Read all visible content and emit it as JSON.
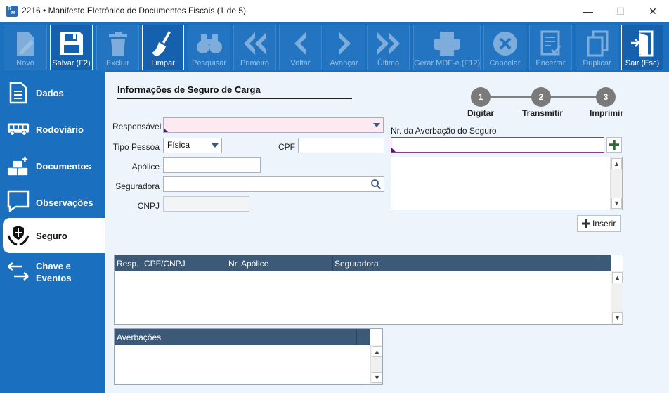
{
  "window": {
    "title": "2216 • Manifesto Eletrônico de Documentos Fiscais (1 de 5)",
    "app_icon_text": [
      "R",
      "M"
    ],
    "minimize": "—",
    "maximize": "☐",
    "close": "✕"
  },
  "toolbar": {
    "buttons": [
      {
        "label": "Novo",
        "icon": "edit-document-icon",
        "enabled": false
      },
      {
        "label": "Salvar (F2)",
        "icon": "save-disk-icon",
        "enabled": true
      },
      {
        "label": "Excluir",
        "icon": "trash-icon",
        "enabled": false
      },
      {
        "label": "Limpar",
        "icon": "broom-icon",
        "enabled": true
      },
      {
        "label": "Pesquisar",
        "icon": "binoculars-icon",
        "enabled": false
      },
      {
        "label": "Primeiro",
        "icon": "double-chevron-left-icon",
        "enabled": false
      },
      {
        "label": "Voltar",
        "icon": "chevron-left-icon",
        "enabled": false
      },
      {
        "label": "Avançar",
        "icon": "chevron-right-icon",
        "enabled": false
      },
      {
        "label": "Último",
        "icon": "double-chevron-right-icon",
        "enabled": false
      },
      {
        "label": "Gerar MDF-e (F12)",
        "icon": "printer-icon",
        "enabled": false
      },
      {
        "label": "Cancelar",
        "icon": "cancel-circle-icon",
        "enabled": false
      },
      {
        "label": "Encerrar",
        "icon": "checklist-icon",
        "enabled": false
      },
      {
        "label": "Duplicar",
        "icon": "copy-icon",
        "enabled": false
      },
      {
        "label": "Sair (Esc)",
        "icon": "exit-door-icon",
        "enabled": true
      }
    ]
  },
  "sidebar": {
    "items": [
      {
        "label": "Dados",
        "icon": "document-icon",
        "active": false
      },
      {
        "label": "Rodoviário",
        "icon": "bus-icon",
        "active": false
      },
      {
        "label": "Documentos",
        "icon": "documents-stack-icon",
        "active": false
      },
      {
        "label": "Observações",
        "icon": "speech-bubble-icon",
        "active": false
      },
      {
        "label": "Seguro",
        "icon": "shield-hands-icon",
        "active": true
      },
      {
        "label": "Chave e\nEventos",
        "icon": "arrows-exchange-icon",
        "active": false
      }
    ]
  },
  "main": {
    "section_title": "Informações de Seguro de Carga",
    "steps": [
      {
        "number": "1",
        "label": "Digitar"
      },
      {
        "number": "2",
        "label": "Transmitir"
      },
      {
        "number": "3",
        "label": "Imprimir"
      }
    ],
    "form": {
      "responsavel_label": "Responsável",
      "responsavel_value": "",
      "tipo_pessoa_label": "Tipo Pessoa",
      "tipo_pessoa_value": "Física",
      "cpf_label": "CPF",
      "cpf_value": "",
      "apolice_label": "Apólice",
      "apolice_value": "",
      "seguradora_label": "Seguradora",
      "seguradora_value": "",
      "cnpj_label": "CNPJ",
      "cnpj_value": "",
      "averbacao_label": "Nr. da Averbação do Seguro",
      "averbacao_value": "",
      "inserir_label": "Inserir"
    },
    "grid_seguros": {
      "columns": [
        "Resp.",
        "CPF/CNPJ",
        "Nr. Apólice",
        "Seguradora"
      ],
      "rows": []
    },
    "grid_averbacoes": {
      "columns": [
        "Averbações"
      ],
      "rows": []
    }
  }
}
